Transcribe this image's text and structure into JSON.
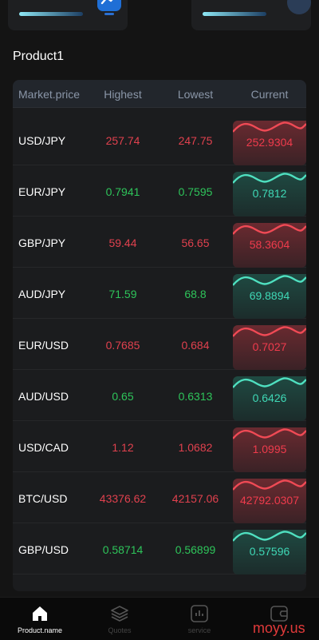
{
  "header": {
    "title": "Product1",
    "left_card_icon": "chart-monitor-icon",
    "right_card_icon": "bell-icon"
  },
  "table": {
    "columns": [
      "Market.price",
      "Highest",
      "Lowest",
      "Current"
    ],
    "rows": [
      {
        "symbol": "USD/JPY",
        "highest": "257.74",
        "lowest": "247.75",
        "current": "252.9304",
        "trend": "down"
      },
      {
        "symbol": "EUR/JPY",
        "highest": "0.7941",
        "lowest": "0.7595",
        "current": "0.7812",
        "trend": "up"
      },
      {
        "symbol": "GBP/JPY",
        "highest": "59.44",
        "lowest": "56.65",
        "current": "58.3604",
        "trend": "down"
      },
      {
        "symbol": "AUD/JPY",
        "highest": "71.59",
        "lowest": "68.8",
        "current": "69.8894",
        "trend": "up"
      },
      {
        "symbol": "EUR/USD",
        "highest": "0.7685",
        "lowest": "0.684",
        "current": "0.7027",
        "trend": "down"
      },
      {
        "symbol": "AUD/USD",
        "highest": "0.65",
        "lowest": "0.6313",
        "current": "0.6426",
        "trend": "up"
      },
      {
        "symbol": "USD/CAD",
        "highest": "1.12",
        "lowest": "1.0682",
        "current": "1.0995",
        "trend": "down"
      },
      {
        "symbol": "BTC/USD",
        "highest": "43376.62",
        "lowest": "42157.06",
        "current": "42792.0307",
        "trend": "down"
      },
      {
        "symbol": "GBP/USD",
        "highest": "0.58714",
        "lowest": "0.56899",
        "current": "0.57596",
        "trend": "up"
      }
    ]
  },
  "tabbar": {
    "tabs": [
      {
        "label": "Product.name",
        "icon": "home-icon",
        "active": true
      },
      {
        "label": "Quotes",
        "icon": "layers-icon",
        "active": false
      },
      {
        "label": "service",
        "icon": "bar-chart-icon",
        "active": false
      },
      {
        "label": "",
        "icon": "wallet-icon",
        "active": false
      }
    ]
  },
  "watermark": "moyy.us",
  "colors": {
    "background": "#141414",
    "card": "#1b1c1e",
    "up": "#2ec45a",
    "down": "#e0414e",
    "accent": "#2a73e0"
  }
}
